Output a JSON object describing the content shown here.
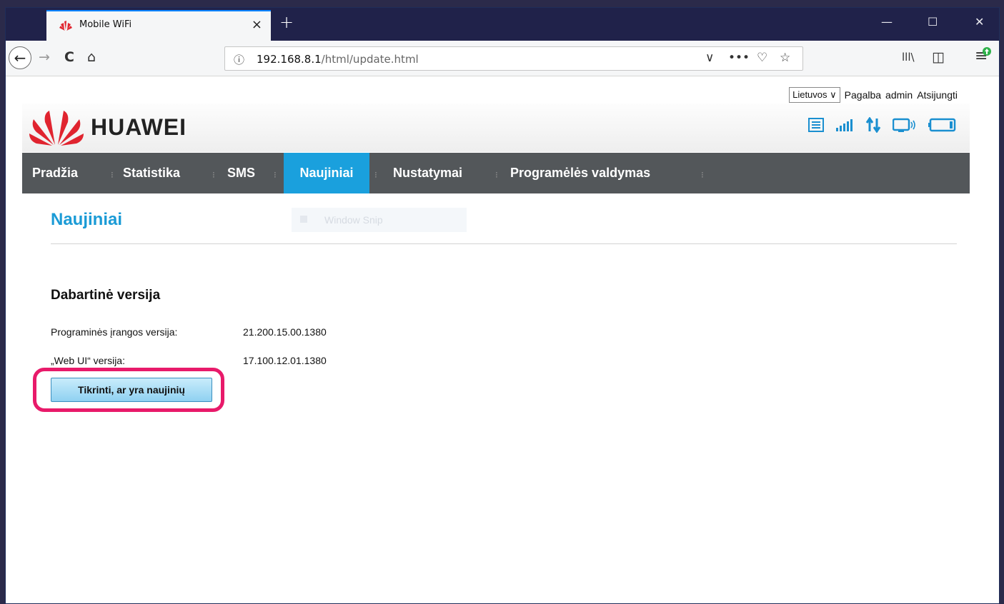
{
  "browser": {
    "tab_title": "Mobile WiFi",
    "tab_close": "×",
    "new_tab": "+",
    "window_controls": {
      "minimize": "—",
      "maximize": "☐",
      "close": "✕"
    },
    "nav": {
      "back": "←",
      "forward": "→",
      "reload": "C",
      "home": "⌂"
    },
    "url_info_icon": "ⓘ",
    "url_host": "192.168.8.1",
    "url_path": "/html/update.html",
    "url_actions": {
      "dropdown": "∨",
      "more": "•••",
      "pocket": "♡",
      "bookmark": "☆"
    },
    "toolbar_right": {
      "library": "lll\\",
      "sidebar": "◫",
      "menu": "≡"
    }
  },
  "top_meta": {
    "language": "Lietuvos",
    "help": "Pagalba",
    "user": "admin",
    "logout": "Atsijungti"
  },
  "brand": {
    "name": "HUAWEI"
  },
  "menu": {
    "items": [
      {
        "label": "Pradžia"
      },
      {
        "label": "Statistika"
      },
      {
        "label": "SMS"
      },
      {
        "label": "Naujiniai"
      },
      {
        "label": "Nustatymai"
      },
      {
        "label": "Programėlės valdymas"
      }
    ],
    "active_index": 3
  },
  "overlay": {
    "snip_label": "Window Snip"
  },
  "main": {
    "title": "Naujiniai",
    "section_title": "Dabartinė versija",
    "rows": [
      {
        "label": "Programinės įrangos versija:",
        "value": "21.200.15.00.1380"
      },
      {
        "label": "„Web UI“ versija:",
        "value": "17.100.12.01.1380"
      }
    ],
    "check_button": "Tikrinti, ar yra naujinių"
  },
  "colors": {
    "accent": "#1aa0dd",
    "menubar": "#53575a",
    "highlight": "#e81a6a",
    "brand_red": "#e0242f",
    "status_blue": "#1a8fd0"
  }
}
